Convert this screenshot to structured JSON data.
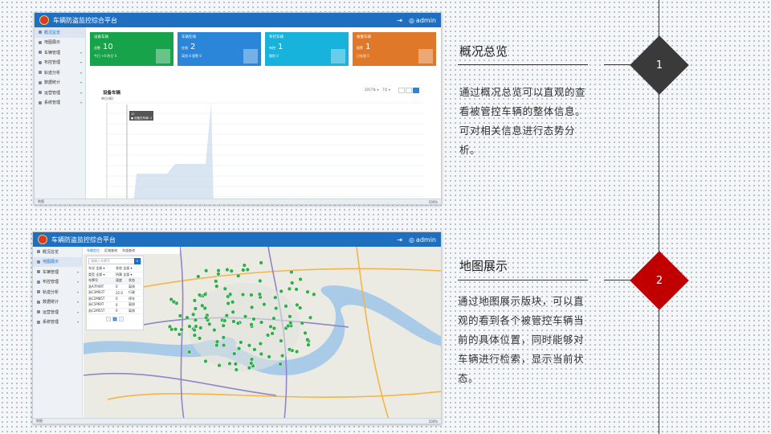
{
  "colors": {
    "diamond1": "#3a3a3a",
    "diamond2": "#c00000",
    "header_blue": "#1f6fc0",
    "card_green": "#16a34a",
    "card_blue": "#2b86d9",
    "card_cyan": "#17b3dd",
    "card_orange": "#e0782a"
  },
  "sections": [
    {
      "number": "1",
      "title": "概况总览",
      "desc": "通过概况总览可以直观的查看被管控车辆的整体信息。可对相关信息进行态势分析。"
    },
    {
      "number": "2",
      "title": "地图展示",
      "desc": "通过地图展示版块，可以直观的看到各个被管控车辆当前的具体位置，同时能够对车辆进行检索，显示当前状态。"
    }
  ],
  "app": {
    "title": "车辆防盗监控综合平台",
    "user": "admin",
    "icons": [
      "logout-icon",
      "user-icon"
    ]
  },
  "shot1": {
    "breadcrumb": "概况总览",
    "sidebar": [
      {
        "label": "地图展示",
        "icon": "user-icon"
      },
      {
        "label": "车辆管理",
        "icon": "car-icon"
      },
      {
        "label": "布控管理",
        "icon": "star-icon"
      },
      {
        "label": "轨迹分析",
        "icon": "route-icon"
      },
      {
        "label": "数据统计",
        "icon": "chart-icon"
      },
      {
        "label": "运营管理",
        "icon": "grid-icon"
      },
      {
        "label": "系统管理",
        "icon": "gear-icon"
      }
    ],
    "cards": [
      {
        "title": "设备车辆",
        "label": "总数",
        "value": "10",
        "foot": "今日 +0    昨日 0",
        "icon": "document-icon"
      },
      {
        "title": "车辆在线",
        "label": "在线",
        "value": "2",
        "foot": "离线 8    报警 0",
        "icon": "car-icon"
      },
      {
        "title": "布控车辆",
        "label": "布控",
        "value": "1",
        "foot": "撤防 0",
        "icon": "trend-icon"
      },
      {
        "title": "报警车辆",
        "label": "报警",
        "value": "1",
        "foot": "已处理 0",
        "icon": "clipboard-icon"
      }
    ],
    "chart": {
      "title": "设备车辆",
      "ylabel": "单位(辆)",
      "month_select": "2017年 ▾",
      "month_select2": "7月 ▾",
      "tooltip_title": "10",
      "tooltip_text": "● 设备在车辆: 2"
    },
    "footer_left": "地图",
    "footer_right": "100%"
  },
  "shot2": {
    "breadcrumb": "地图展示",
    "sidebar": [
      {
        "label": "概况总览",
        "icon": "user-icon"
      },
      {
        "label": "地图展示",
        "icon": "map-icon"
      },
      {
        "label": "车辆管理",
        "icon": "car-icon"
      },
      {
        "label": "布控管理",
        "icon": "star-icon"
      },
      {
        "label": "轨迹分析",
        "icon": "route-icon"
      },
      {
        "label": "数据统计",
        "icon": "chart-icon"
      },
      {
        "label": "运营管理",
        "icon": "grid-icon"
      },
      {
        "label": "系统管理",
        "icon": "gear-icon"
      }
    ],
    "map_tabs": [
      "车辆定位",
      "区域查询",
      "车道查询"
    ],
    "search_placeholder": "请输入车牌号",
    "filters": [
      "车况  全部 ▾",
      "状态  全部 ▾",
      "类型  全部 ▾",
      "所属  全部 ▾"
    ],
    "table_header": [
      "车牌号",
      "速度",
      "状态"
    ],
    "rows": [
      [
        "浙A7P49T",
        "0",
        "离线"
      ],
      [
        "浙C3M03T",
        "22.0",
        "行驶"
      ],
      [
        "浙C2M85T",
        "0",
        "停车"
      ],
      [
        "浙C5P69T",
        "0",
        "离线"
      ],
      [
        "浙C2M55T",
        "0",
        "离线"
      ]
    ],
    "footer_left": "地图",
    "footer_right": "100%"
  }
}
